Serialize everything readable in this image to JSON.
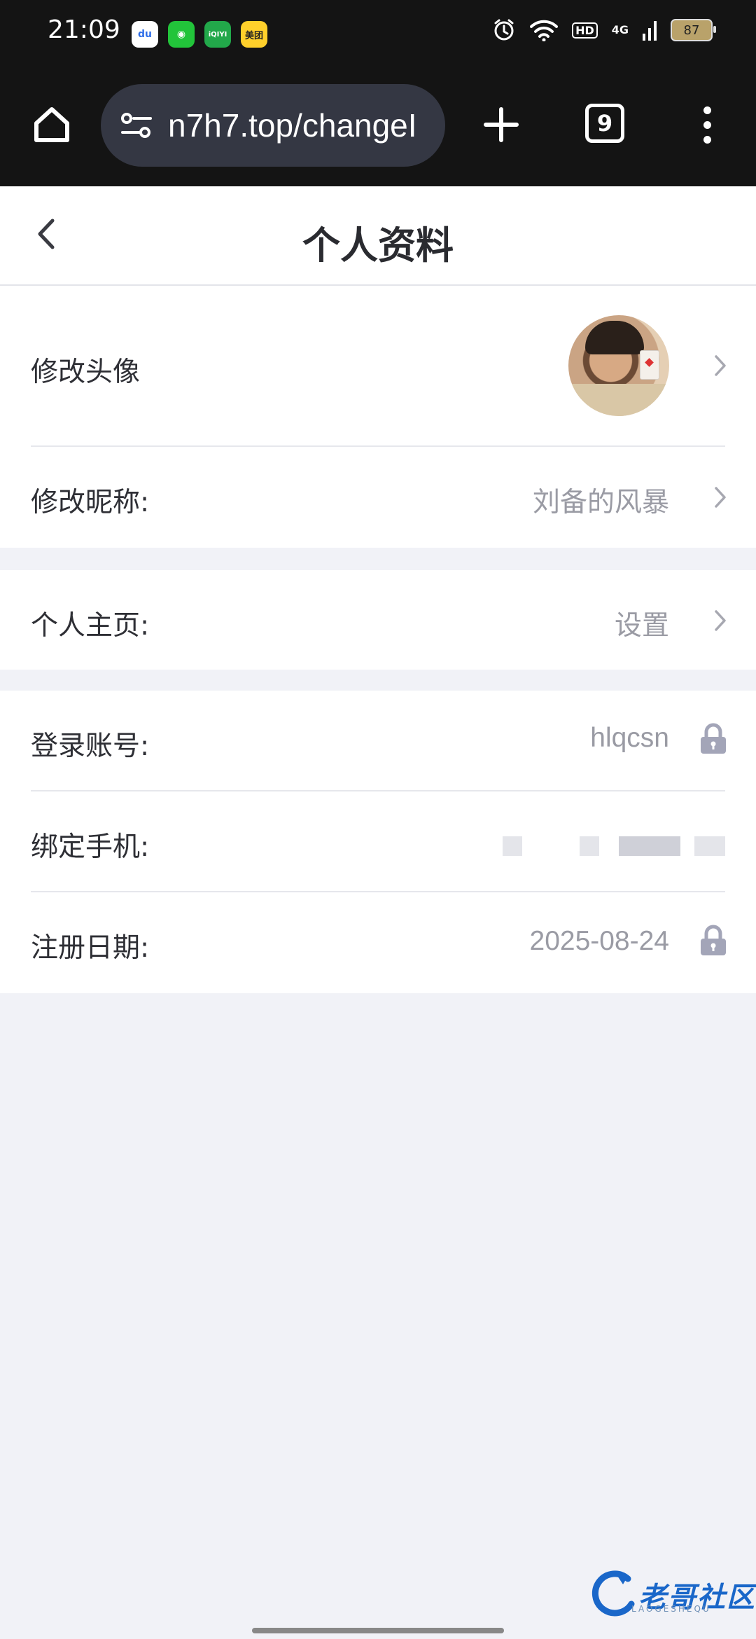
{
  "status_bar": {
    "time": "21:09",
    "apps": [
      {
        "name": "baidu-icon",
        "label": "du",
        "color": "#2f6ee8",
        "bg": "#ffffff"
      },
      {
        "name": "green-app-icon",
        "label": "◉",
        "color": "#ffffff",
        "bg": "#22c43a"
      },
      {
        "name": "iqiyi-icon",
        "label": "iQIYI",
        "color": "#ffffff",
        "bg": "#22a84a"
      },
      {
        "name": "meituan-icon",
        "label": "美团",
        "color": "#222222",
        "bg": "#ffd02b"
      }
    ],
    "hd": "HD",
    "network": "4G",
    "battery": "87"
  },
  "browser": {
    "url": "n7h7.top/changeI",
    "tab_count": "9"
  },
  "header": {
    "title": "个人资料"
  },
  "profile": {
    "avatar_label": "修改头像",
    "nickname_label": "修改昵称:",
    "nickname_value": "刘备的风暴",
    "homepage_label": "个人主页:",
    "homepage_value": "设置",
    "account_label": "登录账号:",
    "account_value": "hlqcsn",
    "phone_label": "绑定手机:",
    "register_label": "注册日期:",
    "register_value": "2025-08-24"
  },
  "watermark": {
    "text": "老哥社区",
    "sub": "LAOGESHEQU"
  },
  "colors": {
    "accent": "#1a67c9",
    "page_bg": "#f1f2f7",
    "value_gray": "#9a9ba4",
    "lock_gray": "#a3a5b8"
  }
}
